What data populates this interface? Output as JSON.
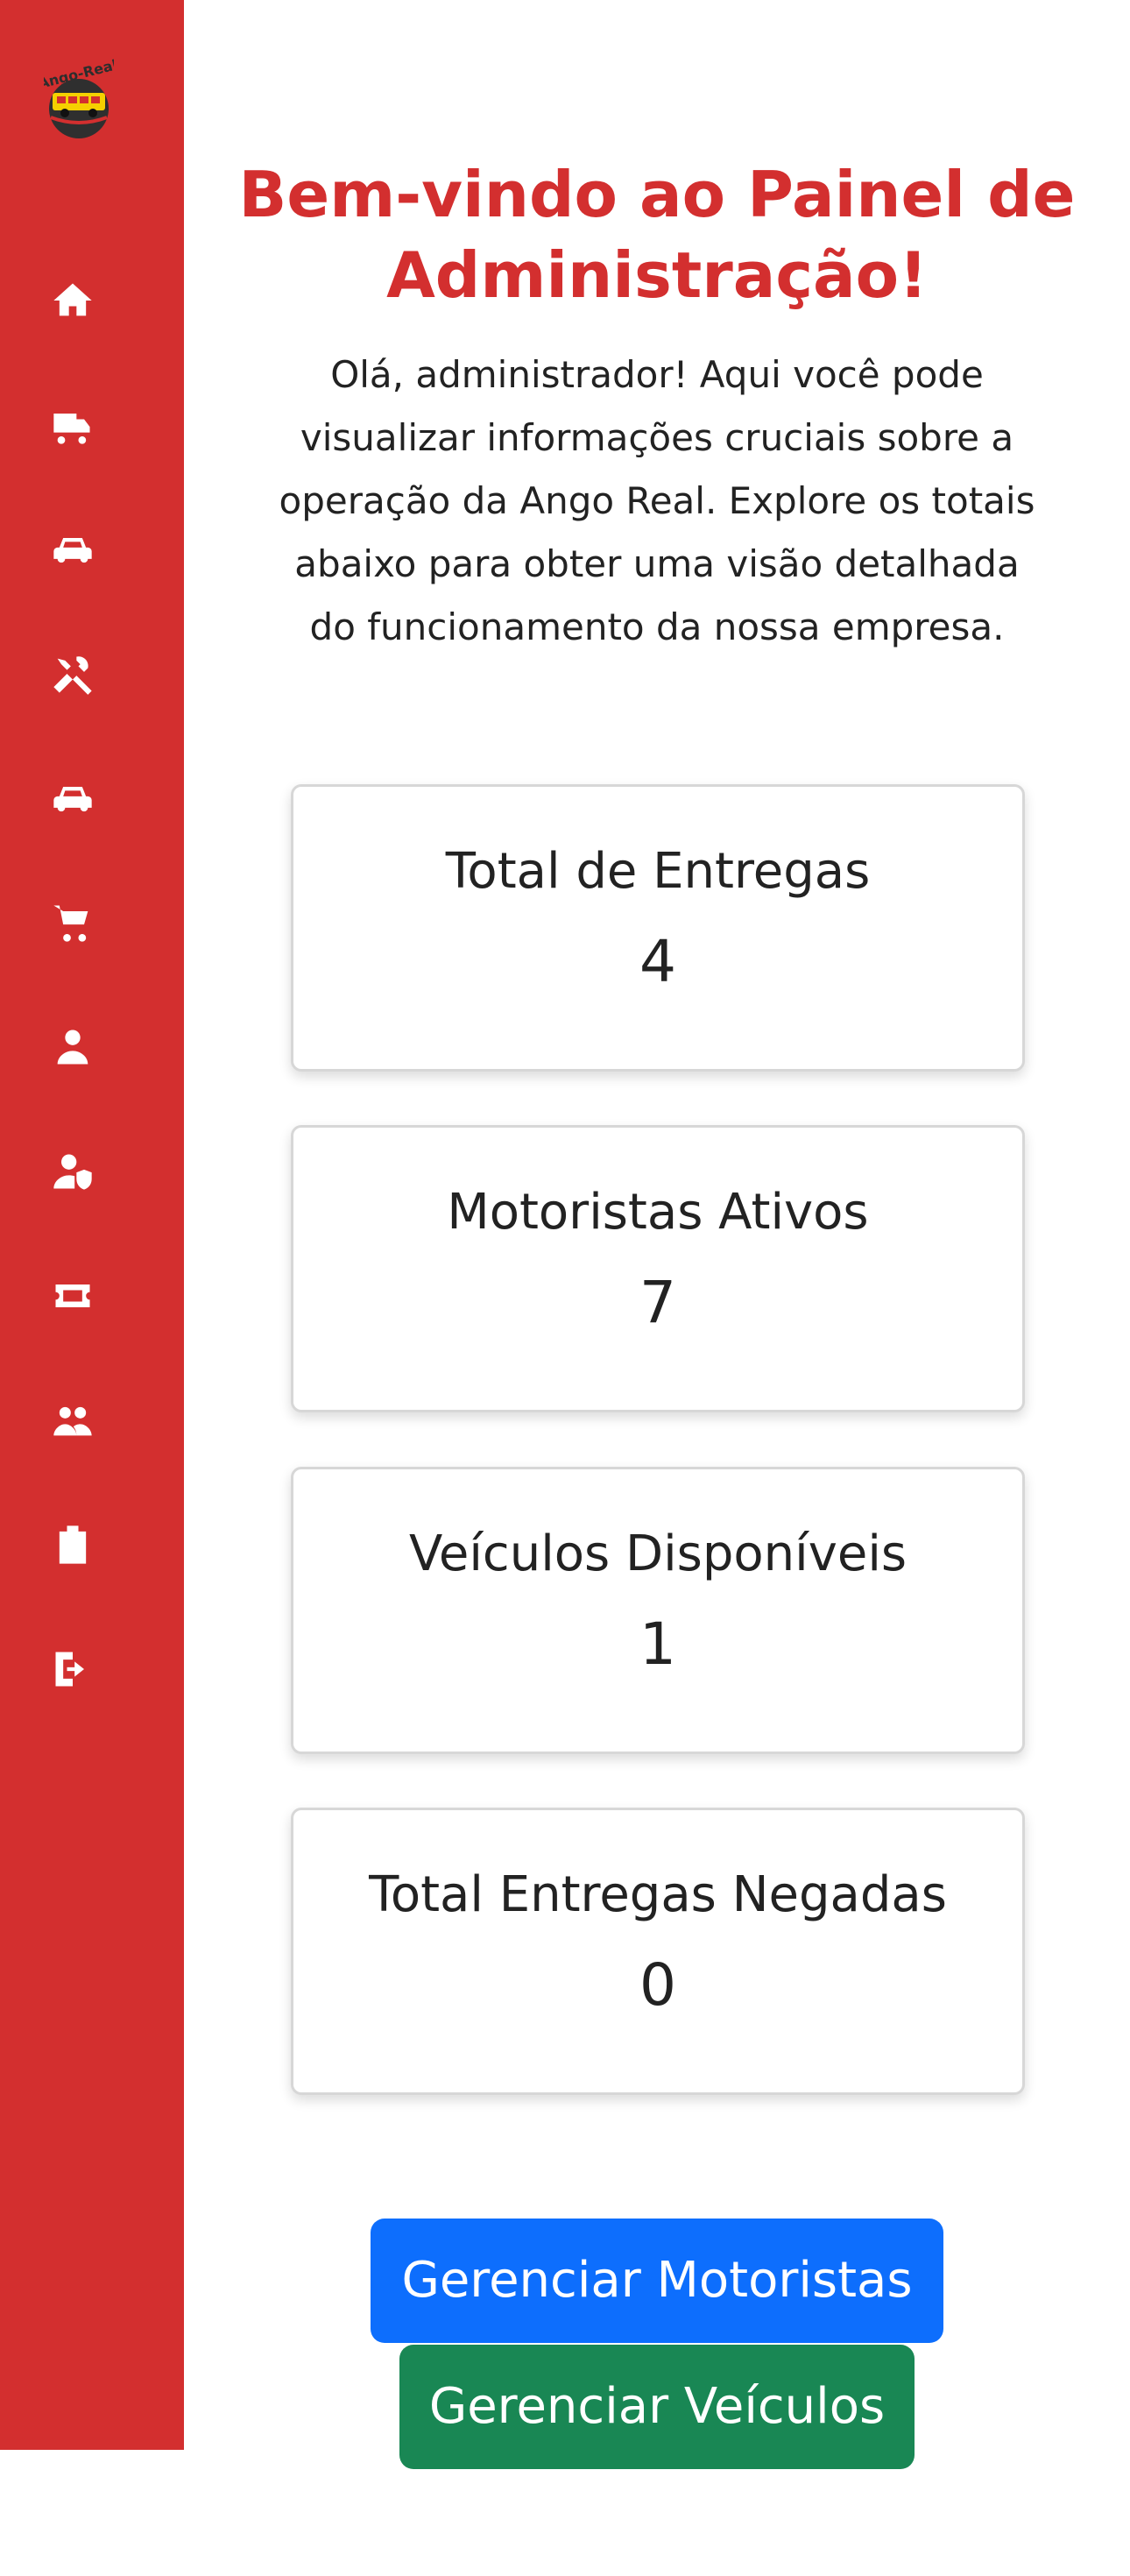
{
  "brand": {
    "logo_text": "Ango-Real"
  },
  "sidebar": {
    "items": [
      {
        "icon": "home-icon"
      },
      {
        "icon": "truck-icon"
      },
      {
        "icon": "car-icon"
      },
      {
        "icon": "tools-icon"
      },
      {
        "icon": "car-icon"
      },
      {
        "icon": "cart-icon"
      },
      {
        "icon": "user-icon"
      },
      {
        "icon": "user-shield-icon"
      },
      {
        "icon": "ticket-icon"
      },
      {
        "icon": "users-icon"
      },
      {
        "icon": "clipboard-list-icon"
      },
      {
        "icon": "logout-icon"
      }
    ]
  },
  "main": {
    "title": "Bem-vindo ao Painel de Administração!",
    "intro": "Olá, administrador! Aqui você pode visualizar informações cruciais sobre a operação da Ango Real. Explore os totais abaixo para obter uma visão detalhada do funcionamento da nossa empresa."
  },
  "stats": [
    {
      "label": "Total de Entregas",
      "value": "4"
    },
    {
      "label": "Motoristas Ativos",
      "value": "7"
    },
    {
      "label": "Veículos Disponíveis",
      "value": "1"
    },
    {
      "label": "Total Entregas Negadas",
      "value": "0"
    }
  ],
  "actions": {
    "manage_drivers": "Gerenciar Motoristas",
    "manage_vehicles": "Gerenciar Veículos"
  },
  "colors": {
    "sidebar": "#d32f2f",
    "title": "#d32f2f",
    "primary": "#0d6efd",
    "success": "#198754"
  }
}
